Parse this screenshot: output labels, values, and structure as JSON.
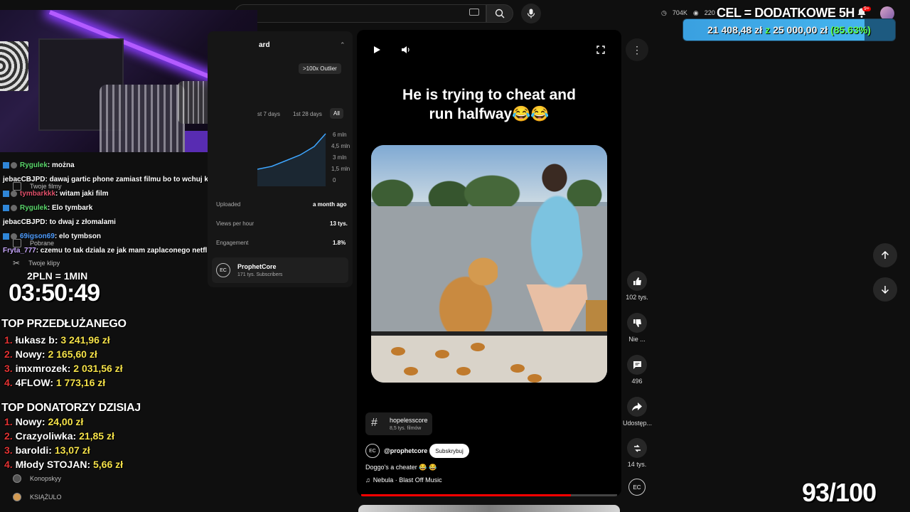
{
  "header": {
    "search_placeholder": "",
    "stats": [
      {
        "icon": "clock-icon",
        "value": "704K"
      },
      {
        "icon": "eye-icon",
        "value": "220"
      }
    ],
    "goal_title": "CEL = DODATKOWE 5H",
    "goal_current": "21 408,48 zł",
    "goal_of": "z",
    "goal_target": "25 000,00 zł",
    "goal_percent": "(85.63%)",
    "goal_progress": 0.8563,
    "notification_badge": "9+"
  },
  "chat": [
    {
      "user": "Rygulek",
      "color": "#5ad66b",
      "badge": true,
      "msg": ": można"
    },
    {
      "user": "jebacCBJPD",
      "color": "#ffffff",
      "badge": false,
      "msg": ": dawaj gartic phone zamiast filmu bo to wchuj kontent"
    },
    {
      "user": "tymbarkkk",
      "color": "#e0506a",
      "badge": true,
      "msg": ": witam jaki film"
    },
    {
      "user": "Rygulek",
      "color": "#5ad66b",
      "badge": true,
      "msg": ": Elo tymbark"
    },
    {
      "user": "jebacCBJPD",
      "color": "#ffffff",
      "badge": false,
      "msg": ": to dwaj z złomalami"
    },
    {
      "user": "69igson69",
      "color": "#4f9dff",
      "badge": true,
      "msg": ": elo tymbson"
    },
    {
      "user": "Fryta_777",
      "color": "#c9a8ff",
      "badge": false,
      "msg": ": czemu to tak dziala ze jak mam zaplaconego netflixa to sa ch"
    }
  ],
  "sidebar": {
    "items": [
      {
        "label": "Twoje filmy"
      },
      {
        "label": "Pobrane"
      },
      {
        "label": "Twoje klipy"
      },
      {
        "label": "Konopskyy"
      },
      {
        "label": "KSIĄŻULO"
      }
    ]
  },
  "overlay": {
    "rate": "2PLN = 1MIN",
    "timer": "03:50:49",
    "top_extended_title": "TOP PRZEDŁUŻANEGO",
    "top_extended": [
      {
        "rank": "1.",
        "name": "łukasz b:",
        "amount": "3 241,96 zł"
      },
      {
        "rank": "2.",
        "name": "Nowy:",
        "amount": "2 165,60 zł"
      },
      {
        "rank": "3.",
        "name": "imxmrozek:",
        "amount": "2 031,56 zł"
      },
      {
        "rank": "4.",
        "name": "4FLOW:",
        "amount": "1 773,16 zł"
      }
    ],
    "top_today_title": "TOP DONATORZY DZISIAJ",
    "top_today": [
      {
        "rank": "1.",
        "name": "Nowy:",
        "amount": "24,00 zł"
      },
      {
        "rank": "2.",
        "name": "Crazyoliwka:",
        "amount": "21,85 zł"
      },
      {
        "rank": "3.",
        "name": "baroldi:",
        "amount": "13,07 zł"
      },
      {
        "rank": "4.",
        "name": "Młody STOJAN:",
        "amount": "5,66 zł"
      }
    ],
    "counter": "93/100"
  },
  "analytics": {
    "title": "ard",
    "outlier": ">100x Outlier",
    "ranges": [
      "st 7 days",
      "1st 28 days",
      "All"
    ],
    "y_ticks": [
      "6 mln",
      "4,5 mln",
      "3 mln",
      "1,5 mln",
      "0"
    ],
    "x_label": "a month ago",
    "rows": [
      {
        "label": "Uploaded",
        "value": "a month ago"
      },
      {
        "label": "Views per hour",
        "value": "13 tys."
      },
      {
        "label": "Engagement",
        "value": "1.8%"
      }
    ],
    "channel_name": "ProphetCore",
    "channel_subs": "171 tys. Subscribers"
  },
  "video": {
    "caption_line1": "He is trying to cheat and",
    "caption_line2": "run halfway😂😂",
    "hashtag": "hopelesscore",
    "hashtag_count": "8,5 tys. filmów",
    "channel": "@prophetcore",
    "subscribe": "Subskrybuj",
    "title": "Doggo's a cheater 😂 😂",
    "music": "Nebula · Blast Off Music",
    "progress": 0.82
  },
  "actions": [
    {
      "name": "like",
      "icon": "thumbs-up-icon",
      "label": "102 tys."
    },
    {
      "name": "dislike",
      "icon": "thumbs-down-icon",
      "label": "Nie ..."
    },
    {
      "name": "comments",
      "icon": "comment-icon",
      "label": "496"
    },
    {
      "name": "share",
      "icon": "share-icon",
      "label": "Udostęp..."
    },
    {
      "name": "remix",
      "icon": "remix-icon",
      "label": "14 tys."
    }
  ]
}
